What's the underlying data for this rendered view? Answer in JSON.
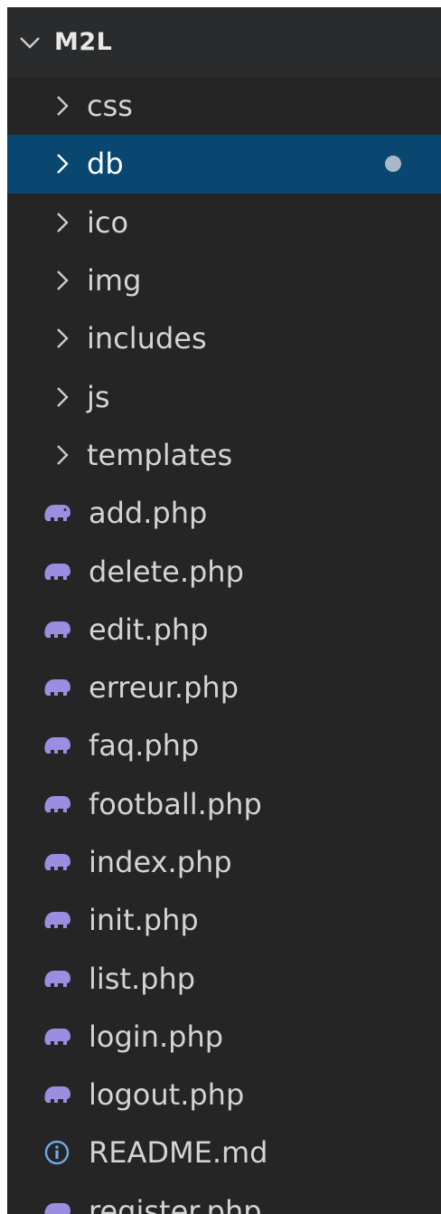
{
  "explorer": {
    "root_label": "M2L",
    "folders": [
      {
        "label": "css",
        "icon": "chevron-right-icon"
      },
      {
        "label": "db",
        "icon": "chevron-right-icon",
        "selected": true,
        "modified_dot": true
      },
      {
        "label": "ico",
        "icon": "chevron-right-icon"
      },
      {
        "label": "img",
        "icon": "chevron-right-icon"
      },
      {
        "label": "includes",
        "icon": "chevron-right-icon"
      },
      {
        "label": "js",
        "icon": "chevron-right-icon"
      },
      {
        "label": "templates",
        "icon": "chevron-right-icon"
      }
    ],
    "files": [
      {
        "label": "add.php",
        "icon": "php-elephant-icon"
      },
      {
        "label": "delete.php",
        "icon": "php-elephant-icon"
      },
      {
        "label": "edit.php",
        "icon": "php-elephant-icon"
      },
      {
        "label": "erreur.php",
        "icon": "php-elephant-icon"
      },
      {
        "label": "faq.php",
        "icon": "php-elephant-icon"
      },
      {
        "label": "football.php",
        "icon": "php-elephant-icon"
      },
      {
        "label": "index.php",
        "icon": "php-elephant-icon"
      },
      {
        "label": "init.php",
        "icon": "php-elephant-icon"
      },
      {
        "label": "list.php",
        "icon": "php-elephant-icon"
      },
      {
        "label": "login.php",
        "icon": "php-elephant-icon"
      },
      {
        "label": "logout.php",
        "icon": "php-elephant-icon"
      },
      {
        "label": "README.md",
        "icon": "info-icon"
      },
      {
        "label": "register.php",
        "icon": "php-elephant-icon"
      }
    ]
  },
  "colors": {
    "background": "#252526",
    "header": "#2a2b2c",
    "selected": "#094771",
    "php_icon": "#9b8de0",
    "info_icon": "#6fa8e8",
    "modified_dot": "#a8b8c8"
  }
}
